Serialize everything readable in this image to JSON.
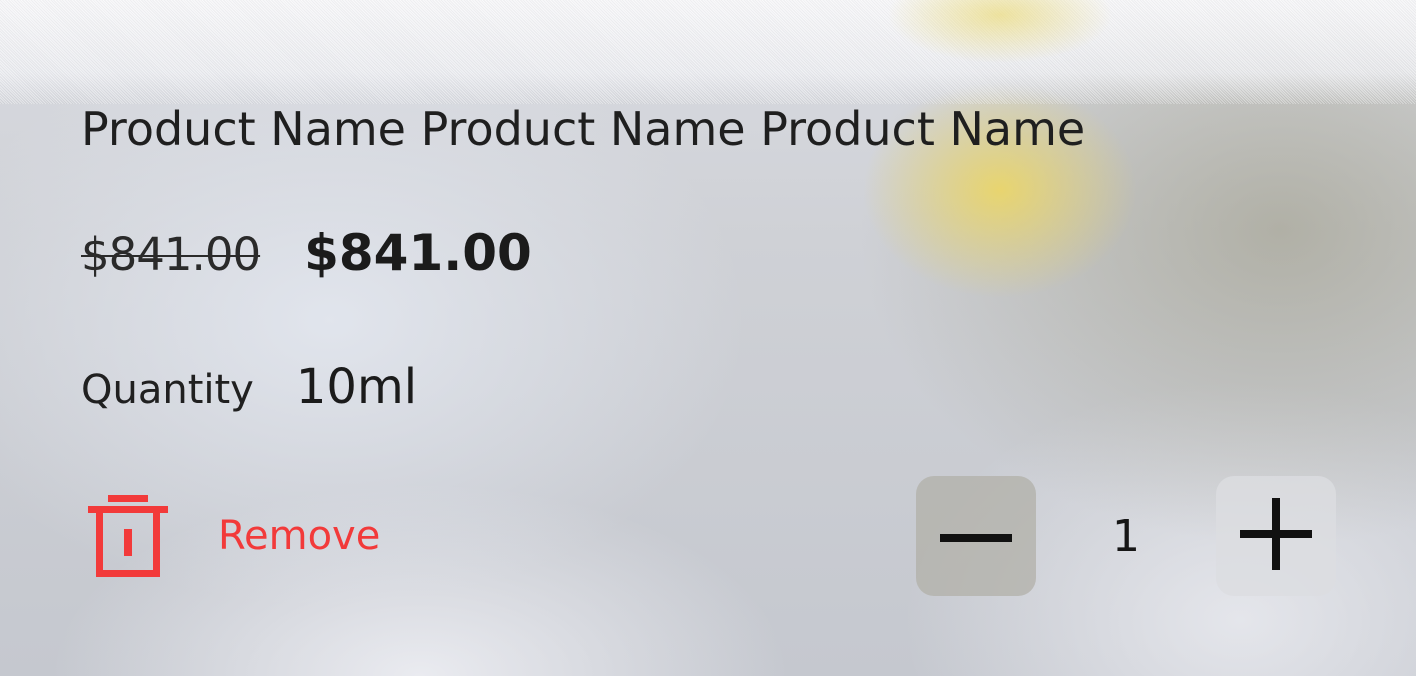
{
  "product": {
    "name": "Product Name Product Name Product Name",
    "original_price": "$841.00",
    "price": "$841.00"
  },
  "quantity": {
    "label": "Quantity",
    "value": "10ml"
  },
  "actions": {
    "remove_label": "Remove"
  },
  "stepper": {
    "count": "1"
  },
  "colors": {
    "remove_red": "#f23a3a",
    "text_dark": "#1f1f1f",
    "minus_button_bg": "#b0aea6",
    "plus_button_bg": "#dcdde0"
  },
  "icons": {
    "remove": "trash-icon",
    "decrease": "minus-icon",
    "increase": "plus-icon"
  }
}
